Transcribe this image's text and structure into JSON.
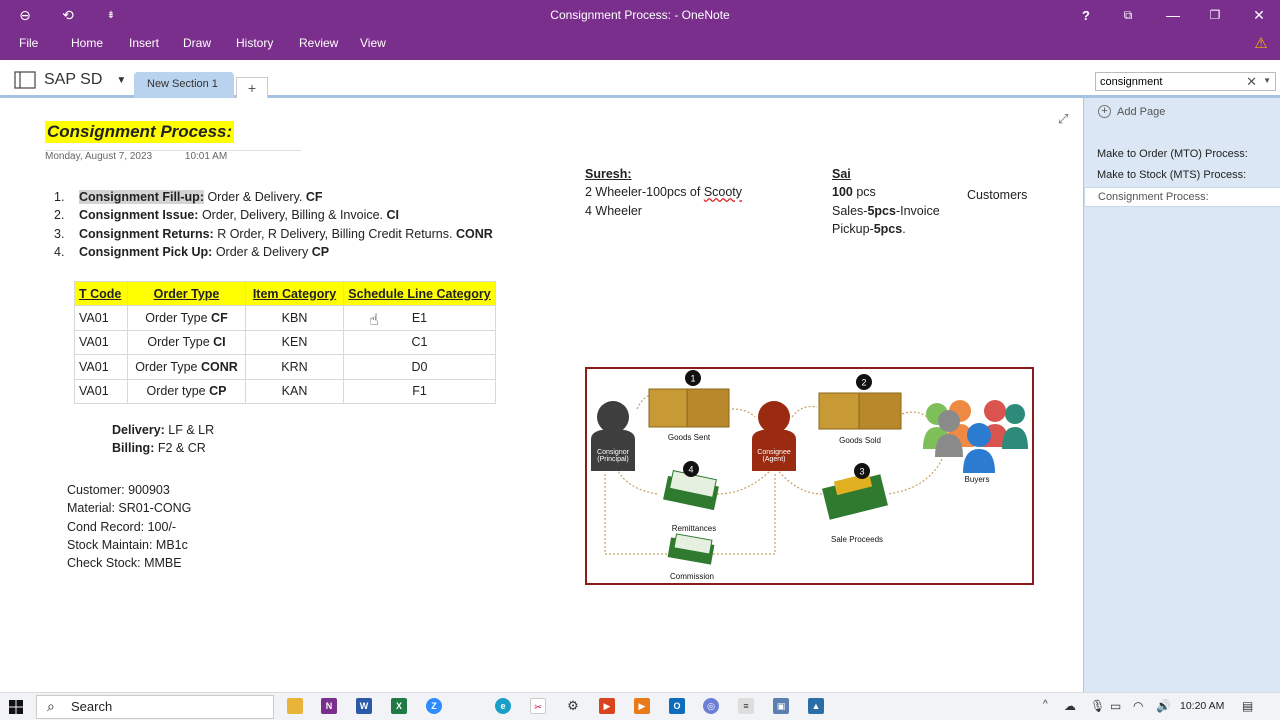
{
  "window": {
    "title": "Consignment Process: - OneNote"
  },
  "ribbon": {
    "menu": [
      "File",
      "Home",
      "Insert",
      "Draw",
      "History",
      "Review",
      "View"
    ]
  },
  "notebook": {
    "name": "SAP SD",
    "section_tab": "New Section 1",
    "add_tab": "+"
  },
  "search": {
    "value": "consignment"
  },
  "page": {
    "title": "Consignment Process:",
    "date": "Monday, August 7, 2023",
    "time": "10:01 AM",
    "steps": [
      {
        "num": "1.",
        "label": "Consignment Fill-up:",
        "text": " Order & Delivery. ",
        "code": "CF"
      },
      {
        "num": "2.",
        "label": "Consignment Issue:",
        "text": " Order, Delivery, Billing & Invoice. ",
        "code": "CI"
      },
      {
        "num": "3.",
        "label": "Consignment Returns:",
        "text": " R Order, R Delivery, Billing Credit Returns. ",
        "code": "CONR"
      },
      {
        "num": "4.",
        "label": "Consignment Pick Up:",
        "text": " Order & Delivery ",
        "code": "CP"
      }
    ],
    "table": {
      "headers": [
        "T Code",
        "Order Type",
        "Item Category",
        "Schedule Line Category"
      ],
      "rows": [
        {
          "tcode": "VA01",
          "order_prefix": "Order Type ",
          "order_code": "CF",
          "item": "KBN",
          "schedule": "E1"
        },
        {
          "tcode": "VA01",
          "order_prefix": "Order Type ",
          "order_code": "CI",
          "item": "KEN",
          "schedule": "C1"
        },
        {
          "tcode": "VA01",
          "order_prefix": "Order Type ",
          "order_code": "CONR",
          "item": "KRN",
          "schedule": "D0"
        },
        {
          "tcode": "VA01",
          "order_prefix": "Order type ",
          "order_code": "CP",
          "item": "KAN",
          "schedule": "F1"
        }
      ]
    },
    "delivery": {
      "label": "Delivery:",
      "value": " LF & LR"
    },
    "billing": {
      "label": "Billing:",
      "value": " F2 & CR"
    },
    "master": [
      "Customer: 900903",
      "Material: SR01-CONG",
      "Cond Record: 100/-",
      "Stock Maintain: MB1c",
      "Check Stock: MMBE"
    ],
    "suresh": {
      "name": "Suresh:",
      "line1_prefix": "2 Wheeler-100pcs of ",
      "line1_word": "Scooty",
      "line2": "4 Wheeler"
    },
    "sai": {
      "name": "Sai",
      "line1_bold": "100",
      "line1_rest": " pcs",
      "line2_a": "Sales-",
      "line2_b": "5pcs",
      "line2_c": "-Invoice",
      "line3_a": "Pickup-",
      "line3_b": "5pcs",
      "line3_c": "."
    },
    "customers": "Customers"
  },
  "diagram": {
    "labels": {
      "consignor": "Consignor\n(Principal)",
      "consignee": "Consignee\n(Agent)",
      "goods_sent": "Goods Sent",
      "goods_sold": "Goods Sold",
      "buyers": "Buyers",
      "remittances": "Remittances",
      "sale_proceeds": "Sale Proceeds",
      "commission": "Commission"
    },
    "steps": [
      "1",
      "2",
      "3",
      "4"
    ]
  },
  "pages_pane": {
    "add_page": "Add Page",
    "pages": [
      "Make to Order (MTO) Process:",
      "Make to Stock (MTS) Process:",
      "Consignment Process:"
    ],
    "active_index": 2
  },
  "taskbar": {
    "search": "Search",
    "time": "10:20 AM"
  },
  "colors": {
    "ribbon": "#7b2f8d",
    "highlight": "#ffff00",
    "section_tab": "#b9d2ed",
    "pane": "#dbe7f4"
  }
}
